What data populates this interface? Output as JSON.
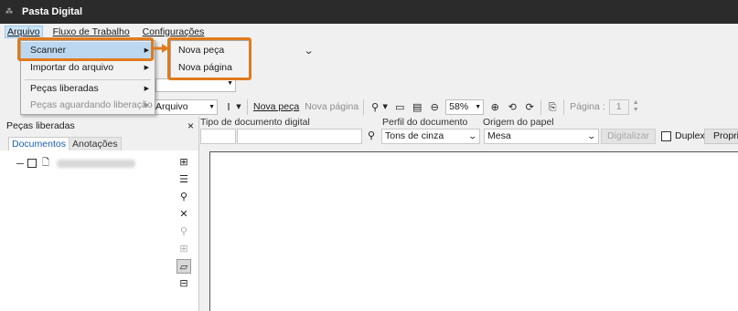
{
  "window": {
    "title": "Pasta Digital"
  },
  "menubar": {
    "items": [
      "Arquivo",
      "Fluxo de Trabalho",
      "Configurações"
    ]
  },
  "arquivo_menu": {
    "items": [
      {
        "label": "Scanner",
        "has_submenu": true
      },
      {
        "label": "Importar do arquivo",
        "has_submenu": true
      },
      {
        "label": "Peças liberadas",
        "has_submenu": true
      },
      {
        "label": "Peças aguardando liberação",
        "has_submenu": true,
        "disabled": true
      }
    ]
  },
  "scanner_submenu": {
    "items": [
      "Nova peça",
      "Nova página"
    ]
  },
  "toolbar": {
    "source_combo": "Arquivo",
    "nova_peca": "Nova peça",
    "nova_pagina": "Nova página",
    "zoom": "58%",
    "page_label": "Página :",
    "page_value": "1"
  },
  "left_panel": {
    "title": "Peças liberadas",
    "close": "×",
    "tabs": [
      "Documentos",
      "Anotações"
    ]
  },
  "scan_form": {
    "tipo_label": "Tipo de documento digital",
    "perfil_label": "Perfil do documento",
    "perfil_value": "Tons de cinza",
    "origem_label": "Origem do papel",
    "origem_value": "Mesa",
    "digitalizar": "Digitalizar",
    "duplex": "Duplex",
    "propriedades": "Propri"
  },
  "colors": {
    "highlight": "#e07a1c",
    "titlebar": "#2b2b2b",
    "menu_hover": "#bcd8f0"
  }
}
